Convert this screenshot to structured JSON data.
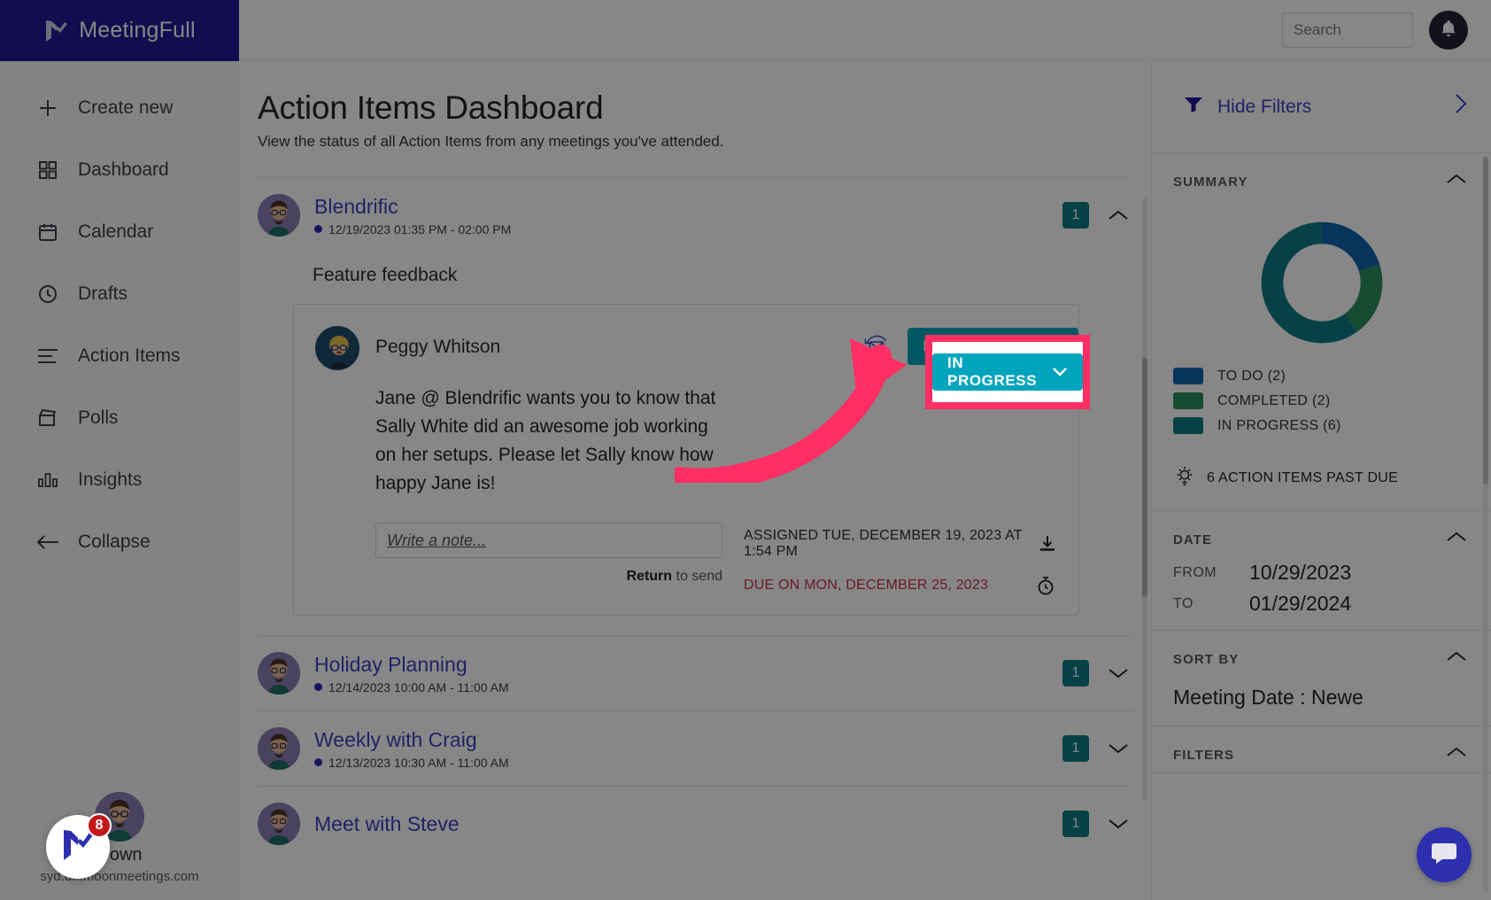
{
  "brand": {
    "name": "MeetingFull",
    "logo_icon": "meetingfull-logo-icon",
    "bg": "#231a95"
  },
  "sidebar": {
    "items": [
      {
        "label": "Create new",
        "icon": "plus-icon"
      },
      {
        "label": "Dashboard",
        "icon": "grid-icon"
      },
      {
        "label": "Calendar",
        "icon": "calendar-icon"
      },
      {
        "label": "Drafts",
        "icon": "clock-icon"
      },
      {
        "label": "Action Items",
        "icon": "list-icon"
      },
      {
        "label": "Polls",
        "icon": "poll-icon"
      },
      {
        "label": "Insights",
        "icon": "bar-chart-icon"
      },
      {
        "label": "Collapse",
        "icon": "arrow-left-icon"
      }
    ],
    "user": {
      "name": "Down",
      "email": "syd.d...moonmeetings.com",
      "avatar_icon": "user-avatar"
    }
  },
  "chat_widget": {
    "badge": "8",
    "icon": "meetingfull-logo-icon"
  },
  "header": {
    "search": {
      "value": "",
      "placeholder": "Search",
      "icon": "search-icon"
    },
    "bell": {
      "icon": "bell-icon"
    }
  },
  "main": {
    "title": "Action Items Dashboard",
    "subtitle": "View the status of all Action Items from any meetings you've attended.",
    "meetings": [
      {
        "title": "Blendrific",
        "datetime": "12/19/2023 01:35 PM - 02:00 PM",
        "badge": "1",
        "chevron": "chevron-up-icon",
        "expanded": true,
        "section_heading": "Feature feedback",
        "action_item": {
          "author": "Peggy Whitson",
          "body": "Jane @ Blendrific wants you to know that Sally White did an awesome job working on her setups. Please let Sally know how happy Jane is!",
          "note_value": "",
          "note_placeholder": "Write a note...",
          "note_hint_bold": "Return",
          "note_hint_rest": " to send",
          "assigned": "ASSIGNED TUE, DECEMBER 19, 2023 AT 1:54 PM",
          "due": "DUE ON MON, DECEMBER 25, 2023",
          "assigned_icon": "download-icon",
          "due_icon": "timer-icon",
          "mail_icon": "resend-email-icon",
          "status": "IN PROGRESS",
          "status_chevron": "chevron-down-icon",
          "status_color": "#00a5bd"
        }
      },
      {
        "title": "Holiday Planning",
        "datetime": "12/14/2023 10:00 AM - 11:00 AM",
        "badge": "1",
        "chevron": "chevron-down-icon",
        "expanded": false
      },
      {
        "title": "Weekly with Craig",
        "datetime": "12/13/2023 10:30 AM - 11:00 AM",
        "badge": "1",
        "chevron": "chevron-down-icon",
        "expanded": false
      },
      {
        "title": "Meet with Steve",
        "datetime": "",
        "badge": "1",
        "chevron": "chevron-down-icon",
        "expanded": false
      }
    ]
  },
  "right_panel": {
    "hide_filters": {
      "label": "Hide Filters",
      "funnel_icon": "funnel-icon",
      "chevron": "chevron-right-icon"
    },
    "summary": {
      "title": "SUMMARY",
      "caret": "chevron-up-icon"
    },
    "past_due": {
      "label": "6 ACTION ITEMS PAST DUE",
      "icon": "lightbulb-icon"
    },
    "date": {
      "title": "DATE",
      "caret": "chevron-up-icon",
      "from_label": "FROM",
      "from_value": "10/29/2023",
      "to_label": "TO",
      "to_value": "01/29/2024"
    },
    "sort_by": {
      "title": "SORT BY",
      "caret": "chevron-up-icon",
      "value": "Meeting Date : Newe"
    },
    "filters": {
      "title": "FILTERS",
      "caret": "chevron-up-icon"
    }
  },
  "chart_data": {
    "type": "pie",
    "title": "SUMMARY",
    "categories": [
      "TO DO",
      "COMPLETED",
      "IN PROGRESS"
    ],
    "values": [
      2,
      2,
      6
    ],
    "colors": [
      "#0f62ad",
      "#2a8c5e",
      "#0d7b84"
    ],
    "legend_labels": [
      "TO DO (2)",
      "COMPLETED (2)",
      "IN PROGRESS (6)"
    ],
    "legend_position": "bottom",
    "donut": true,
    "total": 10
  }
}
